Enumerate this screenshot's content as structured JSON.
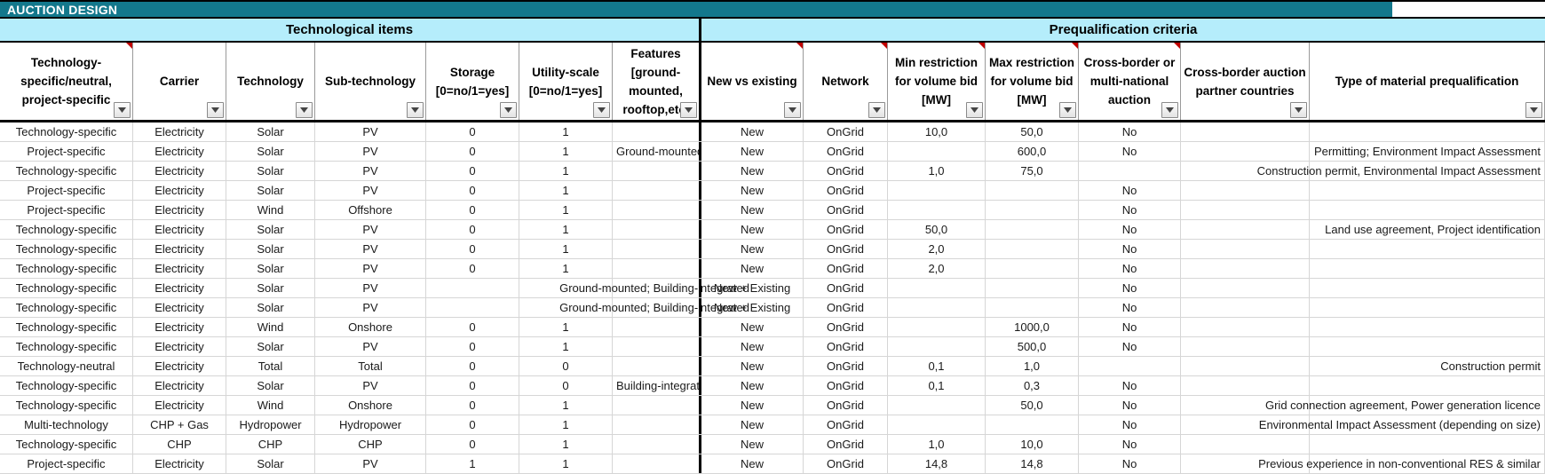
{
  "banner": {
    "title": "AUCTION DESIGN"
  },
  "groups": [
    {
      "label": "Technological items"
    },
    {
      "label": "Prequalification criteria"
    }
  ],
  "columns": [
    {
      "label": "Technology-specific/neutral, project-specific",
      "filter": true,
      "comment": true
    },
    {
      "label": "Carrier",
      "filter": true,
      "comment": false
    },
    {
      "label": "Technology",
      "filter": true,
      "comment": false
    },
    {
      "label": "Sub-technology",
      "filter": true,
      "comment": false
    },
    {
      "label": "Storage [0=no/1=yes]",
      "filter": true,
      "comment": false
    },
    {
      "label": "Utility-scale [0=no/1=yes]",
      "filter": true,
      "comment": false
    },
    {
      "label": "Features [ground-mounted, rooftop,etc.",
      "filter": true,
      "comment": false
    },
    {
      "label": "New vs existing",
      "filter": true,
      "comment": true
    },
    {
      "label": "Network",
      "filter": true,
      "comment": true
    },
    {
      "label": "Min restriction for volume bid [MW]",
      "filter": true,
      "comment": true
    },
    {
      "label": "Max restriction for volume bid [MW]",
      "filter": true,
      "comment": true
    },
    {
      "label": "Cross-border or multi-national auction",
      "filter": true,
      "comment": true
    },
    {
      "label": "Cross-border auction partner countries",
      "filter": true,
      "comment": false
    },
    {
      "label": "Type of material prequalification",
      "filter": true,
      "comment": false
    }
  ],
  "rows": [
    {
      "scope": "Technology-specific",
      "carrier": "Electricity",
      "technology": "Solar",
      "subtech": "PV",
      "storage": "0",
      "utility": "1",
      "features": "",
      "new_vs_existing": "New",
      "network": "OnGrid",
      "min_mw": "10,0",
      "max_mw": "50,0",
      "crossborder": "No",
      "partners": "",
      "material": ""
    },
    {
      "scope": "Project-specific",
      "carrier": "Electricity",
      "technology": "Solar",
      "subtech": "PV",
      "storage": "0",
      "utility": "1",
      "features": "Ground-mounted",
      "new_vs_existing": "New",
      "network": "OnGrid",
      "min_mw": "",
      "max_mw": "600,0",
      "crossborder": "No",
      "partners": "",
      "material": "Permitting; Environment Impact Assessment"
    },
    {
      "scope": "Technology-specific",
      "carrier": "Electricity",
      "technology": "Solar",
      "subtech": "PV",
      "storage": "0",
      "utility": "1",
      "features": "",
      "new_vs_existing": "New",
      "network": "OnGrid",
      "min_mw": "1,0",
      "max_mw": "75,0",
      "crossborder": "",
      "partners": "",
      "material": "Construction permit, Environmental Impact Assessment"
    },
    {
      "scope": "Project-specific",
      "carrier": "Electricity",
      "technology": "Solar",
      "subtech": "PV",
      "storage": "0",
      "utility": "1",
      "features": "",
      "new_vs_existing": "New",
      "network": "OnGrid",
      "min_mw": "",
      "max_mw": "",
      "crossborder": "No",
      "partners": "",
      "material": ""
    },
    {
      "scope": "Project-specific",
      "carrier": "Electricity",
      "technology": "Wind",
      "subtech": "Offshore",
      "storage": "0",
      "utility": "1",
      "features": "",
      "new_vs_existing": "New",
      "network": "OnGrid",
      "min_mw": "",
      "max_mw": "",
      "crossborder": "No",
      "partners": "",
      "material": ""
    },
    {
      "scope": "Technology-specific",
      "carrier": "Electricity",
      "technology": "Solar",
      "subtech": "PV",
      "storage": "0",
      "utility": "1",
      "features": "",
      "new_vs_existing": "New",
      "network": "OnGrid",
      "min_mw": "50,0",
      "max_mw": "",
      "crossborder": "No",
      "partners": "",
      "material": "Land use agreement, Project identification"
    },
    {
      "scope": "Technology-specific",
      "carrier": "Electricity",
      "technology": "Solar",
      "subtech": "PV",
      "storage": "0",
      "utility": "1",
      "features": "",
      "new_vs_existing": "New",
      "network": "OnGrid",
      "min_mw": "2,0",
      "max_mw": "",
      "crossborder": "No",
      "partners": "",
      "material": ""
    },
    {
      "scope": "Technology-specific",
      "carrier": "Electricity",
      "technology": "Solar",
      "subtech": "PV",
      "storage": "0",
      "utility": "1",
      "features": "",
      "new_vs_existing": "New",
      "network": "OnGrid",
      "min_mw": "2,0",
      "max_mw": "",
      "crossborder": "No",
      "partners": "",
      "material": ""
    },
    {
      "scope": "Technology-specific",
      "carrier": "Electricity",
      "technology": "Solar",
      "subtech": "PV",
      "storage": "",
      "utility": "Ground-mounted; Building-integrated",
      "features": "",
      "new_vs_existing": "New + Existing",
      "network": "OnGrid",
      "min_mw": "",
      "max_mw": "",
      "crossborder": "No",
      "partners": "",
      "material": ""
    },
    {
      "scope": "Technology-specific",
      "carrier": "Electricity",
      "technology": "Solar",
      "subtech": "PV",
      "storage": "",
      "utility": "Ground-mounted; Building-integrated",
      "features": "",
      "new_vs_existing": "New + Existing",
      "network": "OnGrid",
      "min_mw": "",
      "max_mw": "",
      "crossborder": "No",
      "partners": "",
      "material": ""
    },
    {
      "scope": "Technology-specific",
      "carrier": "Electricity",
      "technology": "Wind",
      "subtech": "Onshore",
      "storage": "0",
      "utility": "1",
      "features": "",
      "new_vs_existing": "New",
      "network": "OnGrid",
      "min_mw": "",
      "max_mw": "1000,0",
      "crossborder": "No",
      "partners": "",
      "material": ""
    },
    {
      "scope": "Technology-specific",
      "carrier": "Electricity",
      "technology": "Solar",
      "subtech": "PV",
      "storage": "0",
      "utility": "1",
      "features": "",
      "new_vs_existing": "New",
      "network": "OnGrid",
      "min_mw": "",
      "max_mw": "500,0",
      "crossborder": "No",
      "partners": "",
      "material": ""
    },
    {
      "scope": "Technology-neutral",
      "carrier": "Electricity",
      "technology": "Total",
      "subtech": "Total",
      "storage": "0",
      "utility": "0",
      "features": "",
      "new_vs_existing": "New",
      "network": "OnGrid",
      "min_mw": "0,1",
      "max_mw": "1,0",
      "crossborder": "",
      "partners": "",
      "material": "Construction permit"
    },
    {
      "scope": "Technology-specific",
      "carrier": "Electricity",
      "technology": "Solar",
      "subtech": "PV",
      "storage": "0",
      "utility": "0",
      "features": "Building-integrated",
      "new_vs_existing": "New",
      "network": "OnGrid",
      "min_mw": "0,1",
      "max_mw": "0,3",
      "crossborder": "No",
      "partners": "",
      "material": ""
    },
    {
      "scope": "Technology-specific",
      "carrier": "Electricity",
      "technology": "Wind",
      "subtech": "Onshore",
      "storage": "0",
      "utility": "1",
      "features": "",
      "new_vs_existing": "New",
      "network": "OnGrid",
      "min_mw": "",
      "max_mw": "50,0",
      "crossborder": "No",
      "partners": "",
      "material": "Grid connection agreement, Power generation licence"
    },
    {
      "scope": "Multi-technology",
      "carrier": "CHP + Gas",
      "technology": "Hydropower",
      "subtech": "Hydropower",
      "storage": "0",
      "utility": "1",
      "features": "",
      "new_vs_existing": "New",
      "network": "OnGrid",
      "min_mw": "",
      "max_mw": "",
      "crossborder": "No",
      "partners": "",
      "material": "Environmental Impact Assessment (depending on size)"
    },
    {
      "scope": "Technology-specific",
      "carrier": "CHP",
      "technology": "CHP",
      "subtech": "CHP",
      "storage": "0",
      "utility": "1",
      "features": "",
      "new_vs_existing": "New",
      "network": "OnGrid",
      "min_mw": "1,0",
      "max_mw": "10,0",
      "crossborder": "No",
      "partners": "",
      "material": ""
    },
    {
      "scope": "Project-specific",
      "carrier": "Electricity",
      "technology": "Solar",
      "subtech": "PV",
      "storage": "1",
      "utility": "1",
      "features": "",
      "new_vs_existing": "New",
      "network": "OnGrid",
      "min_mw": "14,8",
      "max_mw": "14,8",
      "crossborder": "No",
      "partners": "",
      "material": "Previous experience in non-conventional RES & similar"
    }
  ],
  "icons": {
    "filter_dropdown": "chevron-down-icon",
    "comment_marker": "comment-marker-icon"
  },
  "colors": {
    "banner_bg": "#13788C",
    "group_bg": "#B5EDFB",
    "comment_marker": "#C00000"
  }
}
